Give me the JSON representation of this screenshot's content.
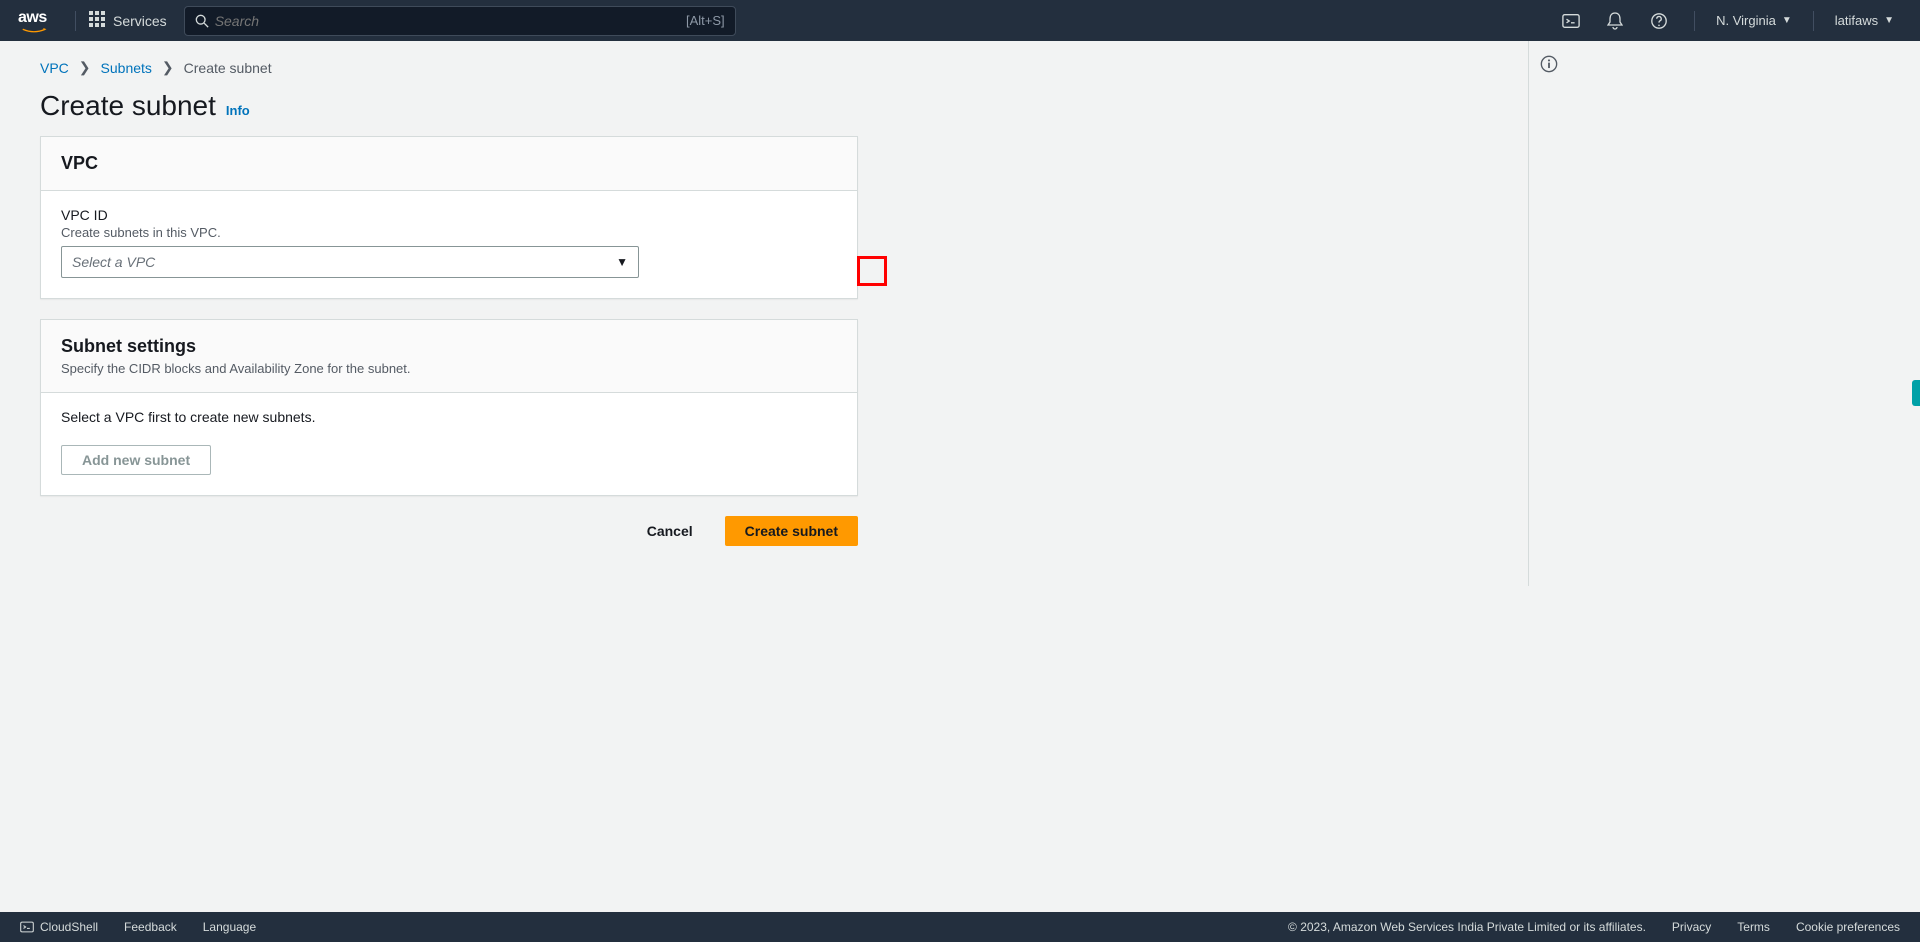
{
  "topnav": {
    "services": "Services",
    "search_placeholder": "Search",
    "search_hint": "[Alt+S]",
    "region": "N. Virginia",
    "user": "latifaws"
  },
  "breadcrumb": {
    "vpc": "VPC",
    "subnets": "Subnets",
    "current": "Create subnet"
  },
  "page": {
    "title": "Create subnet",
    "info": "Info"
  },
  "vpc_card": {
    "header": "VPC",
    "label": "VPC ID",
    "hint": "Create subnets in this VPC.",
    "placeholder": "Select a VPC"
  },
  "subnet_card": {
    "header": "Subnet settings",
    "sub": "Specify the CIDR blocks and Availability Zone for the subnet.",
    "body_text": "Select a VPC first to create new subnets.",
    "add_btn": "Add new subnet"
  },
  "actions": {
    "cancel": "Cancel",
    "create": "Create subnet"
  },
  "footer": {
    "cloudshell": "CloudShell",
    "feedback": "Feedback",
    "language": "Language",
    "copyright": "© 2023, Amazon Web Services India Private Limited or its affiliates.",
    "privacy": "Privacy",
    "terms": "Terms",
    "cookies": "Cookie preferences"
  }
}
